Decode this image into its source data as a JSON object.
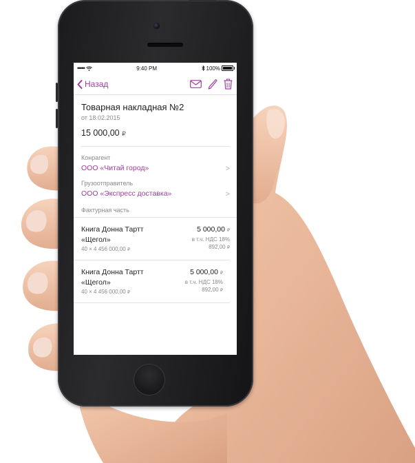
{
  "status_bar": {
    "signal": "•••••",
    "time": "9:40 PM",
    "battery": "100%",
    "battery_level": 1.0
  },
  "navbar": {
    "back_label": "Назад",
    "icons": [
      "envelope-icon",
      "pencil-icon",
      "trash-icon"
    ],
    "accent_color": "#9d3d9d"
  },
  "document": {
    "title": "Товарная накладная №2",
    "date": "от 18.02.2015",
    "amount": "15 000,00",
    "currency": "₽"
  },
  "fields": [
    {
      "label": "Конрагент",
      "value": "ООО «Читай город»"
    },
    {
      "label": "Грузоотправитель",
      "value": "ООО «Экспресс доставка»"
    }
  ],
  "items_section_label": "Фактурная часть",
  "items": [
    {
      "name_line1": "Книга Донна Тартт",
      "name_line2": "«Щегол»",
      "quantity": "40 × 4 456 000,00",
      "total": "5 000,00",
      "vat_label": "в т.ч. НДС 18%",
      "vat_amount": "892,00"
    },
    {
      "name_line1": "Книга Донна Тартт",
      "name_line2": "«Щегол»",
      "quantity": "40 × 4 456 000,00",
      "total": "5 000,00",
      "vat_label": "в т.ч. НДС 18%",
      "vat_amount": "892,00"
    }
  ]
}
